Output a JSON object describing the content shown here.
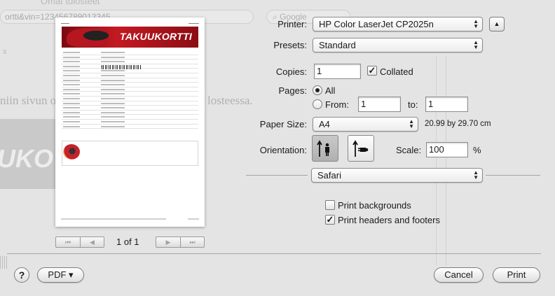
{
  "background": {
    "title": "Omat tulosteet",
    "url": "ortti&vin=123456789012345",
    "search_placeholder": "Google",
    "close_glyph": "x",
    "text_left": "niin sivun o",
    "text_right": "losteessa.",
    "banner_text": "UKO"
  },
  "preview": {
    "banner_text": "TAKUUKORTTI",
    "row_count": 17
  },
  "page_nav": {
    "page_count": "1 of 1"
  },
  "printer": {
    "label": "Printer:",
    "value": "HP Color LaserJet CP2025n"
  },
  "presets": {
    "label": "Presets:",
    "value": "Standard"
  },
  "copies": {
    "label": "Copies:",
    "value": "1",
    "collated_label": "Collated",
    "collated": true
  },
  "pages": {
    "label": "Pages:",
    "all_label": "All",
    "from_label": "From:",
    "from_value": "1",
    "to_label": "to:",
    "to_value": "1",
    "selected": "all"
  },
  "paper_size": {
    "label": "Paper Size:",
    "value": "A4",
    "dimensions": "20.99 by 29.70 cm"
  },
  "orientation": {
    "label": "Orientation:",
    "selected": "portrait"
  },
  "scale": {
    "label": "Scale:",
    "value": "100",
    "unit": "%"
  },
  "section": {
    "value": "Safari"
  },
  "options": {
    "print_backgrounds_label": "Print backgrounds",
    "print_backgrounds": false,
    "print_headers_label": "Print headers and footers",
    "print_headers": true
  },
  "footer": {
    "help": "?",
    "pdf_label": "PDF ▾",
    "cancel_label": "Cancel",
    "print_label": "Print"
  },
  "icons": {
    "first-page": "⏮",
    "prev-page": "◀",
    "next-page": "▶",
    "last-page": "⏭",
    "popup-arrows": "▲▼",
    "disclosure": "▲",
    "checkmark": "✓"
  }
}
